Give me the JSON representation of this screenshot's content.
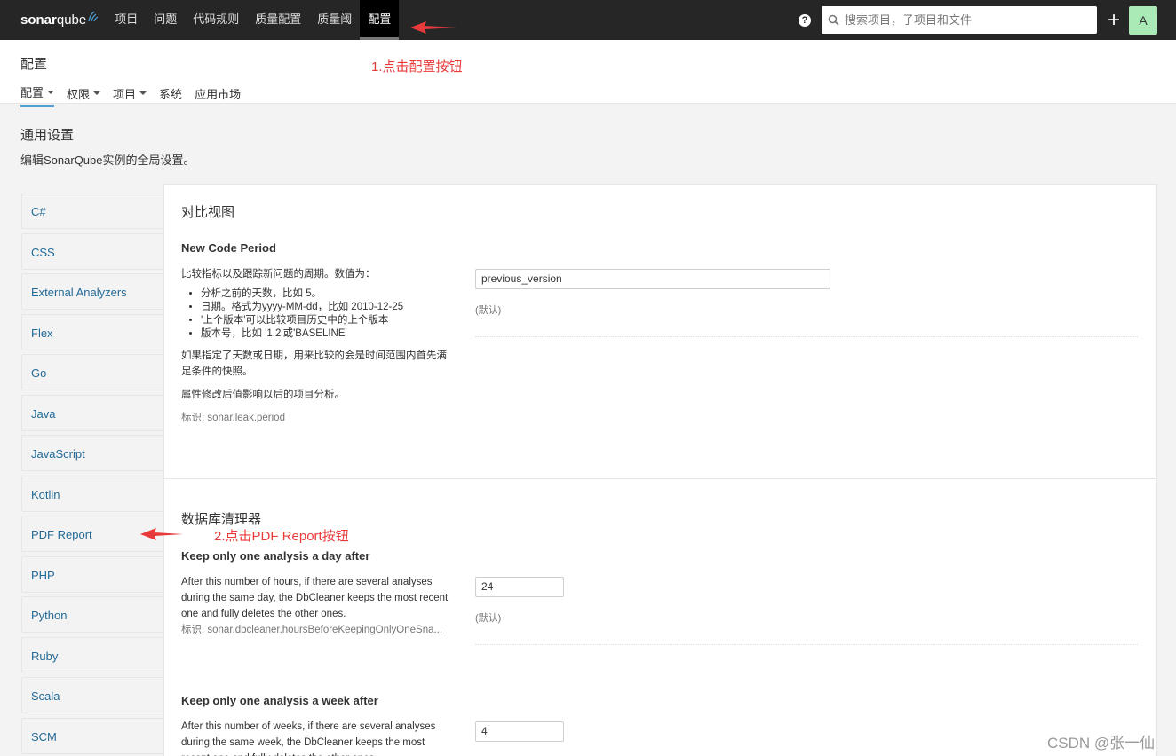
{
  "navbar": {
    "logo_bold": "sonar",
    "logo_thin": "qube",
    "items": [
      {
        "label": "项目"
      },
      {
        "label": "问题"
      },
      {
        "label": "代码规则"
      },
      {
        "label": "质量配置"
      },
      {
        "label": "质量阈"
      },
      {
        "label": "配置",
        "active": true
      }
    ],
    "help_glyph": "?",
    "search_placeholder": "搜索项目，子项目和文件",
    "plus_glyph": "+",
    "avatar_letter": "A",
    "avatar_color": "#aaeab6"
  },
  "header": {
    "title": "配置",
    "subnav": [
      {
        "label": "配置",
        "dropdown": true,
        "active": true
      },
      {
        "label": "权限",
        "dropdown": true
      },
      {
        "label": "项目",
        "dropdown": true
      },
      {
        "label": "系统"
      },
      {
        "label": "应用市场"
      }
    ]
  },
  "annotations": {
    "step1": "1.点击配置按钮",
    "step2": "2.点击PDF Report按钮",
    "color": "#e83a3a"
  },
  "general": {
    "title": "通用设置",
    "description": "编辑SonarQube实例的全局设置。"
  },
  "categories": [
    "C#",
    "CSS",
    "External Analyzers",
    "Flex",
    "Go",
    "Java",
    "JavaScript",
    "Kotlin",
    "PDF Report",
    "PHP",
    "Python",
    "Ruby",
    "Scala",
    "SCM"
  ],
  "sections": {
    "compare": {
      "title": "对比视图",
      "prop": {
        "name": "New Code Period",
        "intro": "比较指标以及跟踪新问题的周期。数值为：",
        "bullets": [
          "分析之前的天数，比如 5。",
          "日期。格式为yyyy-MM-dd，比如 2010-12-25",
          "'上个版本'可以比较项目历史中的上个版本",
          "版本号，比如 '1.2'或'BASELINE'"
        ],
        "note": "如果指定了天数或日期，用来比较的会是时间范围内首先满足条件的快照。",
        "note2": "属性修改后值影响以后的项目分析。",
        "key": "标识: sonar.leak.period",
        "value": "previous_version",
        "default_label": "(默认)"
      }
    },
    "dbcleaner": {
      "title": "数据库清理器",
      "prop1": {
        "name": "Keep only one analysis a day after",
        "desc": "After this number of hours, if there are several analyses during the same day, the DbCleaner keeps the most recent one and fully deletes the other ones.",
        "key": "标识: sonar.dbcleaner.hoursBeforeKeepingOnlyOneSna...",
        "value": "24",
        "default_label": "(默认)"
      },
      "prop2": {
        "name": "Keep only one analysis a week after",
        "desc": "After this number of weeks, if there are several analyses during the same week, the DbCleaner keeps the most recent one and fully deletes the other ones.",
        "value": "4"
      }
    }
  },
  "watermark": "CSDN @张一仙"
}
